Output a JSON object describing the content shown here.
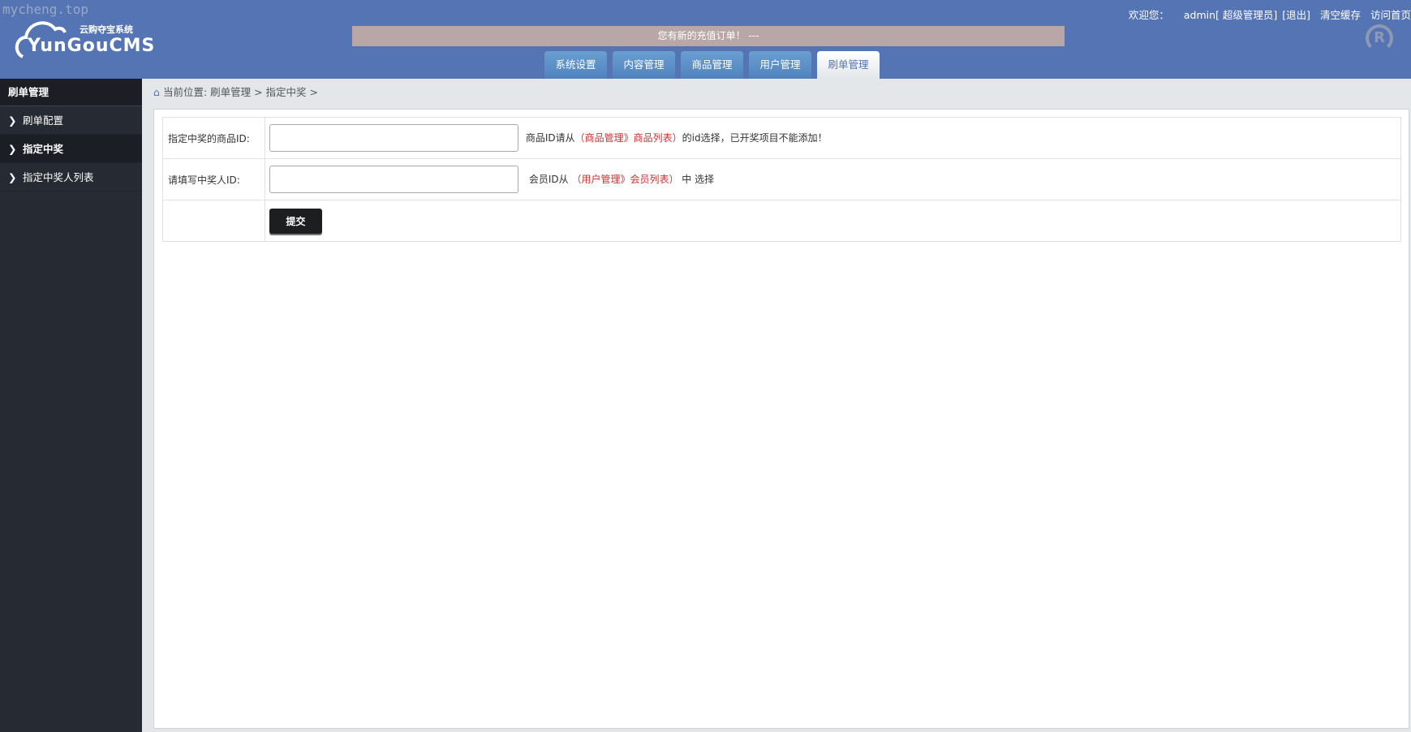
{
  "watermark": "mycheng.top",
  "logo": {
    "sub": "云购夺宝系统",
    "main": "YunGouCMS"
  },
  "notice": "您有新的充值订单！ ---",
  "tabs": [
    {
      "label": "系统设置"
    },
    {
      "label": "内容管理"
    },
    {
      "label": "商品管理"
    },
    {
      "label": "用户管理"
    },
    {
      "label": "刷单管理",
      "active": true
    }
  ],
  "topbar": {
    "welcome": "欢迎您：",
    "user": "admin[ 超级管理员]",
    "logout": "[退出]",
    "clear_cache": "清空缓存",
    "visit_home": "访问首页"
  },
  "sidebar": {
    "title": "刷单管理",
    "items": [
      {
        "label": "刷单配置"
      },
      {
        "label": "指定中奖",
        "active": true
      },
      {
        "label": "指定中奖人列表"
      }
    ]
  },
  "breadcrumb": "当前位置: 刷单管理 > 指定中奖 >",
  "form": {
    "row1": {
      "label": "指定中奖的商品ID:",
      "value": "",
      "hint_pre": "商品ID请从",
      "hint_link": "（商品管理》商品列表）",
      "hint_post": "的id选择，已开奖项目不能添加！"
    },
    "row2": {
      "label": "请填写中奖人ID:",
      "value": "",
      "hint_pre": "会员ID从",
      "hint_link": "（用户管理》会员列表）",
      "hint_post": "中 选择"
    },
    "submit": "提交"
  },
  "colors": {
    "header": "#5474b4",
    "sidebar": "#252a33",
    "link_red": "#cc3333"
  }
}
